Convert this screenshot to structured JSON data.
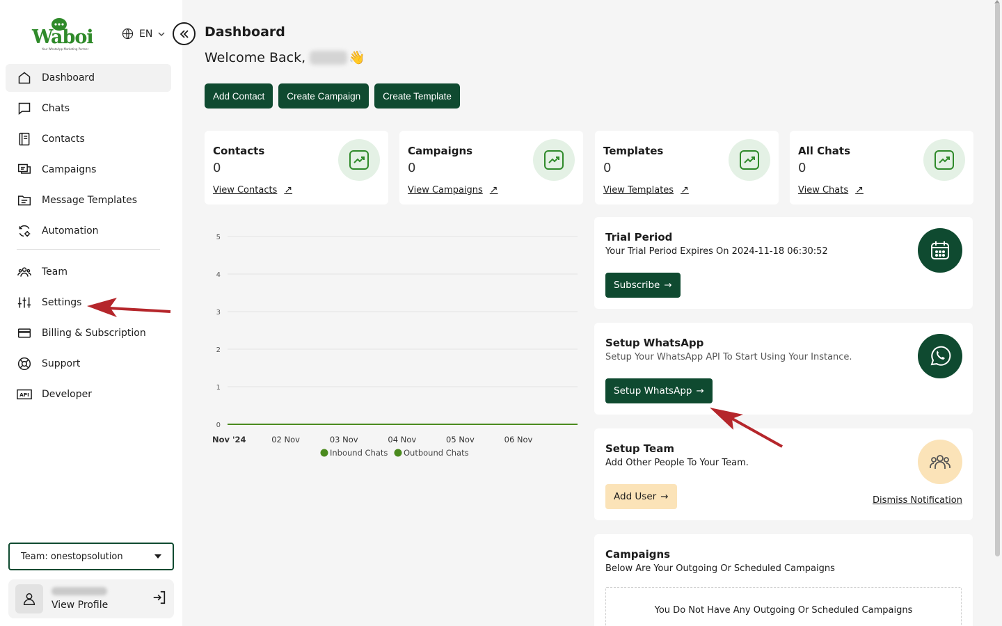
{
  "brand": {
    "logo_text": "Waboi",
    "tagline": "Your WhatsApp Marketing Partner"
  },
  "lang": {
    "label": "EN"
  },
  "sidebar": {
    "items": [
      {
        "label": "Dashboard",
        "icon": "home-icon"
      },
      {
        "label": "Chats",
        "icon": "chat-icon"
      },
      {
        "label": "Contacts",
        "icon": "contacts-icon"
      },
      {
        "label": "Campaigns",
        "icon": "campaigns-icon"
      },
      {
        "label": "Message Templates",
        "icon": "template-icon"
      },
      {
        "label": "Automation",
        "icon": "automation-icon"
      },
      {
        "label": "Team",
        "icon": "team-icon"
      },
      {
        "label": "Settings",
        "icon": "sliders-icon"
      },
      {
        "label": "Billing & Subscription",
        "icon": "card-icon"
      },
      {
        "label": "Support",
        "icon": "lifebuoy-icon"
      },
      {
        "label": "Developer",
        "icon": "api-icon"
      }
    ],
    "team_select": "Team: onestopsolution",
    "profile_link": "View Profile"
  },
  "header": {
    "title": "Dashboard",
    "welcome": "Welcome Back,",
    "wave": "👋"
  },
  "actions": {
    "add_contact": "Add Contact",
    "create_campaign": "Create Campaign",
    "create_template": "Create Template"
  },
  "stats": [
    {
      "title": "Contacts",
      "value": "0",
      "link": "View Contacts"
    },
    {
      "title": "Campaigns",
      "value": "0",
      "link": "View Campaigns"
    },
    {
      "title": "Templates",
      "value": "0",
      "link": "View Templates"
    },
    {
      "title": "All Chats",
      "value": "0",
      "link": "View Chats"
    }
  ],
  "trial": {
    "title": "Trial Period",
    "text": "Your Trial Period Expires On 2024-11-18 06:30:52",
    "button": "Subscribe"
  },
  "whatsapp": {
    "title": "Setup WhatsApp",
    "text": "Setup Your WhatsApp API To Start Using Your Instance.",
    "button": "Setup WhatsApp"
  },
  "team_setup": {
    "title": "Setup Team",
    "text": "Add Other People To Your Team.",
    "button": "Add User",
    "dismiss": "Dismiss Notification"
  },
  "campaigns_panel": {
    "title": "Campaigns",
    "text": "Below Are Your Outgoing Or Scheduled Campaigns",
    "empty": "You Do Not Have Any Outgoing Or Scheduled Campaigns"
  },
  "colors": {
    "brand_dark": "#0f4a30",
    "brand_green": "#2f8a2a",
    "accent_peach": "#fbe3b8",
    "icon_bg": "#e4f1e5"
  },
  "chart_data": {
    "type": "line",
    "categories": [
      "Nov '24",
      "02 Nov",
      "03 Nov",
      "04 Nov",
      "05 Nov",
      "06 Nov"
    ],
    "series": [
      {
        "name": "Inbound Chats",
        "values": [
          0,
          0,
          0,
          0,
          0,
          0
        ],
        "color": "#4a8a1e"
      },
      {
        "name": "Outbound Chats",
        "values": [
          0,
          0,
          0,
          0,
          0,
          0
        ],
        "color": "#4a8a1e"
      }
    ],
    "y_ticks": [
      "0",
      "1",
      "2",
      "3",
      "4",
      "5"
    ],
    "ylim": [
      0,
      5
    ],
    "grid": true,
    "legend": "bottom"
  }
}
